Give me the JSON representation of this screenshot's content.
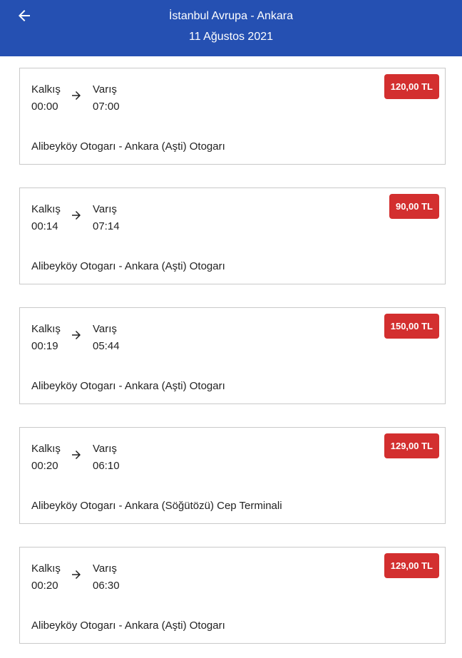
{
  "header": {
    "title": "İstanbul Avrupa - Ankara",
    "date": "11 Ağustos 2021",
    "background_color": "#2550b2",
    "back_icon": "arrow-left-icon"
  },
  "labels": {
    "departure": "Kalkış",
    "arrival": "Varış"
  },
  "trips": [
    {
      "departure_time": "00:00",
      "arrival_time": "07:00",
      "price": "120,00 TL",
      "route": "Alibeyköy Otogarı - Ankara (Aşti) Otogarı"
    },
    {
      "departure_time": "00:14",
      "arrival_time": "07:14",
      "price": "90,00 TL",
      "route": "Alibeyköy Otogarı - Ankara (Aşti) Otogarı"
    },
    {
      "departure_time": "00:19",
      "arrival_time": "05:44",
      "price": "150,00 TL",
      "route": "Alibeyköy Otogarı - Ankara (Aşti) Otogarı"
    },
    {
      "departure_time": "00:20",
      "arrival_time": "06:10",
      "price": "129,00 TL",
      "route": "Alibeyköy Otogarı - Ankara (Söğütözü) Cep Terminali"
    },
    {
      "departure_time": "00:20",
      "arrival_time": "06:30",
      "price": "129,00 TL",
      "route": "Alibeyköy Otogarı - Ankara (Aşti) Otogarı"
    }
  ],
  "colors": {
    "price_badge": "#d32f2f",
    "card_border": "#c9c9c9"
  }
}
